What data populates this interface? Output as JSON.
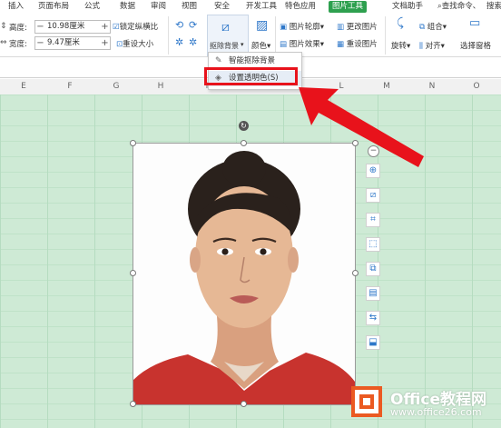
{
  "menu": {
    "items": [
      "插入",
      "页面布局",
      "公式",
      "数据",
      "审阅",
      "视图",
      "安全",
      "开发工具",
      "特色应用",
      "图片工具",
      "文档助手"
    ],
    "active": "图片工具",
    "search": "查找命令、",
    "search2": "搜索"
  },
  "ribbon": {
    "height_label": "高度:",
    "height_value": "10.98厘米",
    "width_label": "宽度:",
    "width_value": "9.47厘米",
    "lock_ratio": "锁定纵横比",
    "reset_size": "重设大小",
    "remove_bg": "抠除背景",
    "color": "颜色",
    "outline": "图片轮廓",
    "change_picture": "更改图片",
    "picture_effects": "图片效果",
    "reset_picture": "重设图片",
    "group": "组合",
    "rotate": "旋转",
    "align": "对齐",
    "select_pane": "选择窗格",
    "minus": "−",
    "plus": "+"
  },
  "columns": [
    "E",
    "F",
    "G",
    "H",
    "I",
    "J",
    "K",
    "L",
    "M",
    "N",
    "O"
  ],
  "dropdown": {
    "items": [
      "智能抠除背景",
      "设置透明色(S)"
    ]
  },
  "watermark": {
    "brand": "Office教程网",
    "url": "www.office26.com"
  },
  "colors": {
    "accent": "#2ea04f",
    "highlight": "#e8121b",
    "grid": "#ceead5",
    "logo": "#eb5a22"
  }
}
